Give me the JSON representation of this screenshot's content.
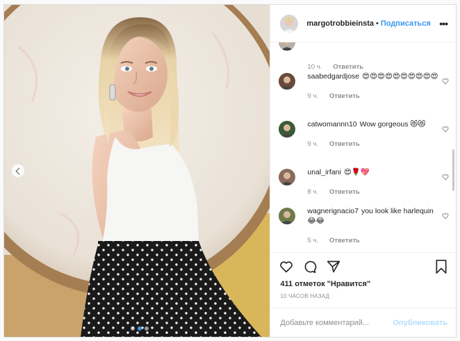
{
  "header": {
    "username": "margotrobbieinsta",
    "separator": "•",
    "follow_label": "Подписаться",
    "more_label": "•••",
    "avatar_icon": "profile-avatar"
  },
  "photo": {
    "prev_icon": "chevron-left-icon",
    "carousel_dots": 3,
    "active_dot": 1
  },
  "comments": [
    {
      "user": "",
      "text": "",
      "time": "10 ч.",
      "reply_label": "Ответить",
      "avatar_color": "#b9b0a8"
    },
    {
      "user": "saabedgardjose",
      "text": "😍😍😍😍😍😍😍😍😍😍",
      "time": "9 ч.",
      "reply_label": "Ответить",
      "avatar_color": "#6a4a3a"
    },
    {
      "user": "catwomannn10",
      "text": "Wow gorgeous 😻😻",
      "time": "9 ч.",
      "reply_label": "Ответить",
      "avatar_color": "#3d5a36"
    },
    {
      "user": "unal_irfani",
      "text": "😍🌹💖",
      "time": "8 ч.",
      "reply_label": "Ответить",
      "avatar_color": "#8a6a5a"
    },
    {
      "user": "wagnerignacio7",
      "text": "you look like harlequin 😂😂",
      "time": "5 ч.",
      "reply_label": "Ответить",
      "avatar_color": "#6f7a4a"
    }
  ],
  "actions": {
    "like_icon": "heart-icon",
    "comment_icon": "comment-icon",
    "share_icon": "share-icon",
    "save_icon": "bookmark-icon"
  },
  "likes_text": "411 отметок \"Нравится\"",
  "time_ago": "10 часов назад",
  "add_comment": {
    "placeholder": "Добавьте комментарий...",
    "publish_label": "Опубликовать"
  },
  "colors": {
    "link": "#3897f0",
    "publish_disabled": "#b2dffc",
    "meta": "#8e8e8e",
    "border": "#dbdbdb"
  }
}
